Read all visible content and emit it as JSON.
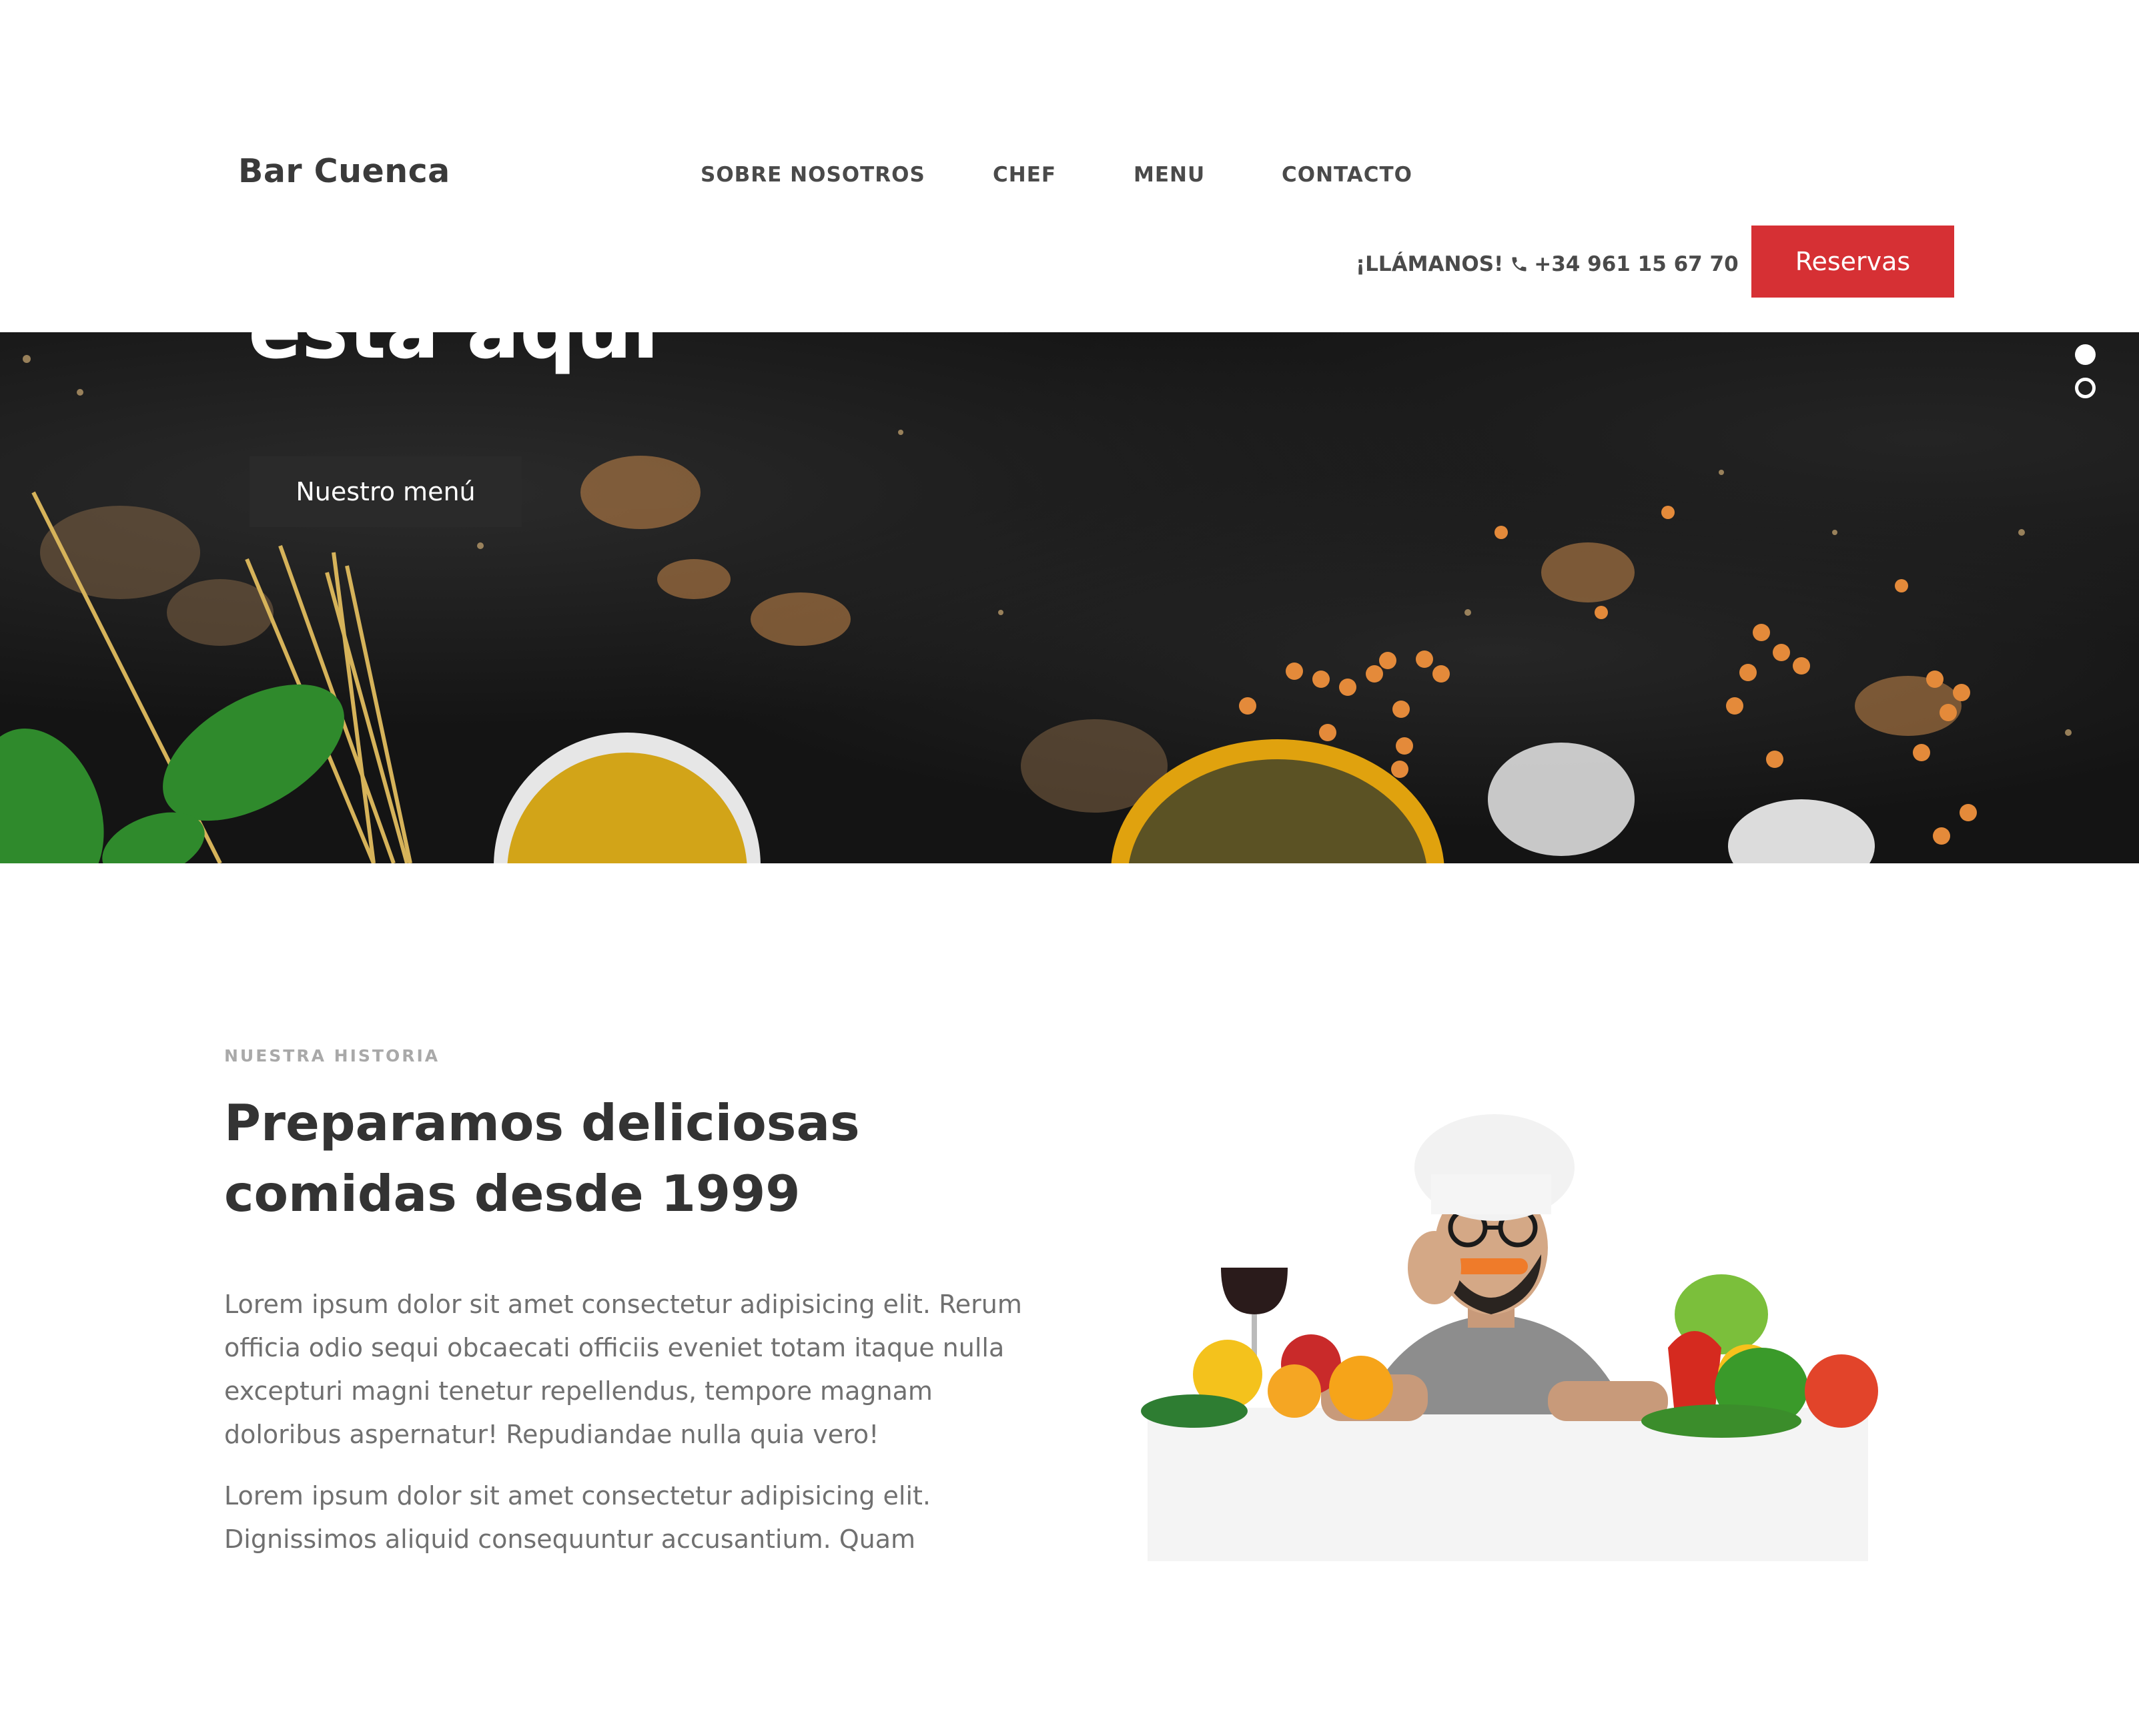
{
  "header": {
    "logo": "Bar Cuenca",
    "nav": [
      "SOBRE NOSOTROS",
      "CHEF",
      "MENU",
      "CONTACTO"
    ],
    "call_label": "¡LLÁMANOS!",
    "phone": "+34 961 15 67 70",
    "reserve_label": "Reservas",
    "accent": "#d63034"
  },
  "hero": {
    "title": "está aquí",
    "button_label": "Nuestro menú",
    "slides": 2,
    "active_slide": 1
  },
  "story": {
    "eyebrow": "NUESTRA HISTORIA",
    "title": "Preparamos deliciosas comidas desde 1999",
    "paragraph_1": "Lorem ipsum dolor sit amet consectetur adipisicing elit. Rerum officia odio sequi obcaecati officiis eveniet totam itaque nulla excepturi magni tenetur repellendus, tempore magnam doloribus aspernatur! Repudiandae nulla quia vero!",
    "paragraph_2": "Lorem ipsum dolor sit amet consectetur adipisicing elit. Dignissimos aliquid consequuntur accusantium. Quam"
  }
}
